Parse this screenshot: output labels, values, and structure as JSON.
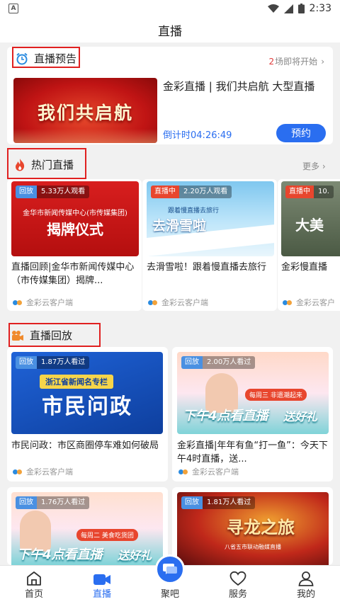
{
  "status": {
    "time": "2:33",
    "app_icon_letter": "A"
  },
  "header": {
    "title": "直播"
  },
  "preview": {
    "section_title": "直播预告",
    "count": "2",
    "count_suffix": "场即将开始",
    "chevron": "›",
    "item_title": "金彩直播 | 我们共启航 大型直播",
    "countdown_label": "倒计时",
    "countdown": "04:26:49",
    "reserve_button": "预约",
    "thumb_text": "我们共启航"
  },
  "hot": {
    "section_title": "热门直播",
    "more": "更多 ›",
    "items": [
      {
        "badge": "回放",
        "views": "5.33万人观看",
        "banner_top": "金华市新闻传媒中心(市传媒集团)",
        "banner_main": "揭牌仪式",
        "caption": "直播回顾|金华市新闻传媒中心（市传媒集团）揭牌...",
        "source": "金彩云客户端"
      },
      {
        "badge": "直播中",
        "views": "2.20万人观看",
        "banner_top": "跟着慢直播去旅行",
        "banner_main": "去滑雪啦",
        "caption": "去滑雪啦！跟着慢直播去旅行",
        "source": "金彩云客户端"
      },
      {
        "badge": "直播中",
        "views": "10.",
        "banner_main": "大美",
        "caption": "金彩慢直播",
        "source": "金彩云客户"
      }
    ]
  },
  "replay": {
    "section_title": "直播回放",
    "items": [
      {
        "badge": "回放",
        "views": "1.87万人看过",
        "banner_top": "浙江省新闻名专栏",
        "banner_main": "市民问政",
        "caption": "市民问政：市区商圈停车难如何破局",
        "source": "金彩云客户端"
      },
      {
        "badge": "回放",
        "views": "2.00万人看过",
        "banner_sub": "每周三 非遗潮起来",
        "banner_main": "下午4点看直播",
        "banner_gift": "送好礼",
        "caption": "金彩直播|年年有鱼“打一鱼”：今天下午4时直播，送...",
        "source": "金彩云客户端"
      },
      {
        "badge": "回放",
        "views": "1.76万人看过",
        "banner_sub": "每周二 美食吃货团",
        "banner_main": "下午4点看直播",
        "banner_gift": "送好礼"
      },
      {
        "badge": "回放",
        "views": "1.81万人看过",
        "banner_main": "寻龙之旅",
        "banner_sub": "八省五市联动融媒直播"
      }
    ]
  },
  "tabbar": {
    "items": [
      {
        "label": "首页",
        "icon": "home-icon"
      },
      {
        "label": "直播",
        "icon": "video-icon"
      },
      {
        "label": "聚吧",
        "icon": "chat-icon"
      },
      {
        "label": "服务",
        "icon": "heart-icon"
      },
      {
        "label": "我的",
        "icon": "user-icon"
      }
    ],
    "active_color": "#2a6ef0"
  }
}
